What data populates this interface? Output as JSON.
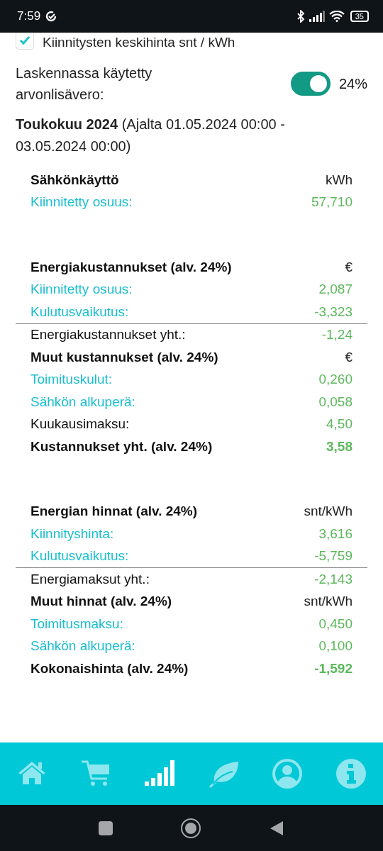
{
  "status_bar": {
    "time": "7:59",
    "battery": "35"
  },
  "settings": {
    "checkbox": {
      "label": "Kiinnitysten keskihinta snt / kWh",
      "checked": true
    },
    "vat": {
      "label": "Laskennassa käytetty arvonlisävero:",
      "on": true,
      "value": "24%"
    }
  },
  "period": {
    "month": "Toukokuu 2024",
    "range": "(Ajalta 01.05.2024 00:00 - 03.05.2024 00:00)"
  },
  "sections": [
    {
      "rows": [
        {
          "kind": "header",
          "label": "Sähkönkäyttö",
          "value": "kWh"
        },
        {
          "kind": "item",
          "label": "Kiinnitetty osuus:",
          "value": "57,710"
        }
      ]
    },
    {
      "rows": [
        {
          "kind": "header",
          "label": "Energiakustannukset (alv. 24%)",
          "value": "€"
        },
        {
          "kind": "item",
          "label": "Kiinnitetty osuus:",
          "value": "2,087"
        },
        {
          "kind": "item",
          "label": "Kulutusvaikutus:",
          "value": "-3,323"
        },
        {
          "kind": "subtotal",
          "label": "Energiakustannukset yht.:",
          "value": "-1,24"
        },
        {
          "kind": "header",
          "label": "Muut kustannukset (alv. 24%)",
          "value": "€"
        },
        {
          "kind": "item",
          "label": "Toimituskulut:",
          "value": "0,260"
        },
        {
          "kind": "item",
          "label": "Sähkön alkuperä:",
          "value": "0,058"
        },
        {
          "kind": "total",
          "label": "Kuukausimaksu:",
          "value": "4,50"
        },
        {
          "kind": "grand",
          "label": "Kustannukset yht. (alv. 24%)",
          "value": "3,58"
        }
      ]
    },
    {
      "rows": [
        {
          "kind": "header",
          "label": "Energian hinnat (alv. 24%)",
          "value": "snt/kWh"
        },
        {
          "kind": "item",
          "label": "Kiinnityshinta:",
          "value": "3,616"
        },
        {
          "kind": "item",
          "label": "Kulutusvaikutus:",
          "value": "-5,759"
        },
        {
          "kind": "subtotal",
          "label": "Energiamaksut yht.:",
          "value": "-2,143"
        },
        {
          "kind": "header",
          "label": "Muut hinnat (alv. 24%)",
          "value": "snt/kWh"
        },
        {
          "kind": "item",
          "label": "Toimitusmaksu:",
          "value": "0,450"
        },
        {
          "kind": "item",
          "label": "Sähkön alkuperä:",
          "value": "0,100"
        },
        {
          "kind": "grand",
          "label": "Kokonaishinta (alv. 24%)",
          "value": "-1,592"
        }
      ]
    }
  ],
  "bottom_nav": [
    {
      "kind": "home",
      "selected": false
    },
    {
      "kind": "cart",
      "selected": false
    },
    {
      "kind": "signal",
      "selected": true
    },
    {
      "kind": "leaf",
      "selected": false
    },
    {
      "kind": "user",
      "selected": false
    },
    {
      "kind": "info",
      "selected": false
    }
  ]
}
